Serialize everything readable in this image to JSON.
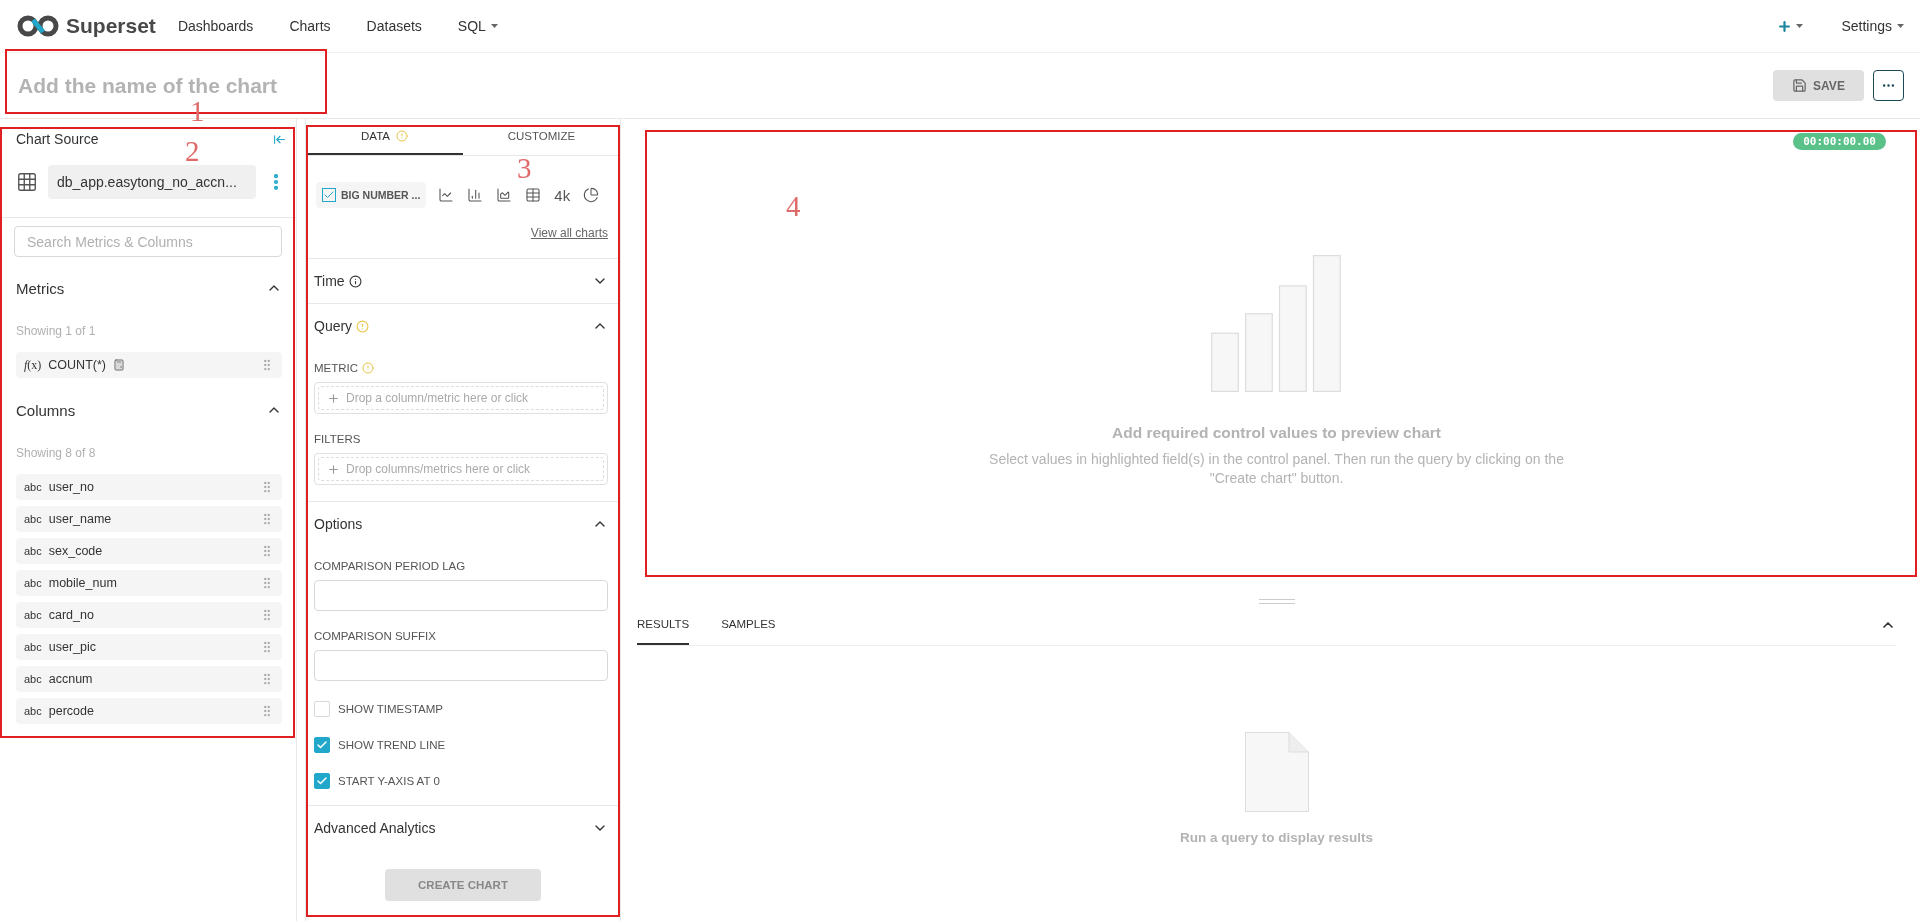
{
  "navbar": {
    "brand": "Superset",
    "items": [
      {
        "label": "Dashboards",
        "dropdown": false
      },
      {
        "label": "Charts",
        "dropdown": false
      },
      {
        "label": "Datasets",
        "dropdown": false
      },
      {
        "label": "SQL",
        "dropdown": true
      }
    ],
    "settings": "Settings"
  },
  "chart_title": {
    "placeholder": "Add the name of the chart"
  },
  "header_actions": {
    "save": "SAVE"
  },
  "datasource": {
    "heading": "Chart Source",
    "dataset": "db_app.easytong_no_accn...",
    "search": {
      "placeholder": "Search Metrics & Columns"
    },
    "sections": [
      {
        "title": "Metrics",
        "expanded": true,
        "count": "Showing 1 of 1",
        "items": [
          {
            "kind": "metric",
            "type_label": "*f*(x)",
            "name": "COUNT(*)"
          }
        ]
      },
      {
        "title": "Columns",
        "expanded": true,
        "count": "Showing 8 of 8",
        "items": [
          {
            "kind": "column",
            "type_label": "abc",
            "name": "user_no"
          },
          {
            "kind": "column",
            "type_label": "abc",
            "name": "user_name"
          },
          {
            "kind": "column",
            "type_label": "abc",
            "name": "sex_code"
          },
          {
            "kind": "column",
            "type_label": "abc",
            "name": "mobile_num"
          },
          {
            "kind": "column",
            "type_label": "abc",
            "name": "card_no"
          },
          {
            "kind": "column",
            "type_label": "abc",
            "name": "user_pic"
          },
          {
            "kind": "column",
            "type_label": "abc",
            "name": "accnum"
          },
          {
            "kind": "column",
            "type_label": "abc",
            "name": "percode"
          }
        ]
      }
    ]
  },
  "control_panel": {
    "tabs": [
      {
        "label": "DATA",
        "selected": true,
        "warning": true
      },
      {
        "label": "CUSTOMIZE",
        "selected": false,
        "warning": false
      }
    ],
    "viz_types": [
      {
        "kind": "chip",
        "label": "BIG NUMBER ...",
        "selected": true
      },
      {
        "kind": "line",
        "selected": false
      },
      {
        "kind": "bar",
        "selected": false
      },
      {
        "kind": "area",
        "selected": false
      },
      {
        "kind": "table",
        "selected": false
      },
      {
        "kind": "text",
        "label": "4k",
        "selected": false
      },
      {
        "kind": "pie",
        "selected": false
      }
    ],
    "view_all": "View all charts",
    "sections": [
      {
        "title": "Time",
        "info": true,
        "warning": false,
        "expanded": false
      },
      {
        "title": "Query",
        "info": false,
        "warning": true,
        "expanded": true,
        "controls": [
          {
            "kind": "dropzone",
            "label": "METRIC",
            "warning": true,
            "placeholder": "Drop a column/metric here or click"
          },
          {
            "kind": "dropzone",
            "label": "FILTERS",
            "warning": false,
            "placeholder": "Drop columns/metrics here or click"
          }
        ]
      },
      {
        "title": "Options",
        "info": false,
        "warning": false,
        "expanded": true,
        "controls": [
          {
            "kind": "text",
            "label": "COMPARISON PERIOD LAG"
          },
          {
            "kind": "text",
            "label": "COMPARISON SUFFIX"
          },
          {
            "kind": "checkbox",
            "label": "SHOW TIMESTAMP",
            "checked": false
          },
          {
            "kind": "checkbox",
            "label": "SHOW TREND LINE",
            "checked": true
          },
          {
            "kind": "checkbox",
            "label": "START Y-AXIS AT 0",
            "checked": true
          }
        ]
      },
      {
        "title": "Advanced Analytics",
        "info": false,
        "warning": false,
        "expanded": false
      }
    ],
    "create_button": {
      "label": "CREATE CHART",
      "disabled": true
    }
  },
  "chart_area": {
    "timer": "00:00:00.00",
    "title": "Add required control values to preview chart",
    "description": "Select values in highlighted field(s) in the control panel. Then run the query by clicking on the \"Create chart\" button."
  },
  "data_pane": {
    "tabs": [
      {
        "label": "RESULTS",
        "selected": true
      },
      {
        "label": "SAMPLES",
        "selected": false
      }
    ],
    "expanded": true,
    "empty_message": "Run a query to display results"
  },
  "annotations": [
    {
      "number": "1"
    },
    {
      "number": "2"
    },
    {
      "number": "3"
    },
    {
      "number": "4"
    }
  ]
}
